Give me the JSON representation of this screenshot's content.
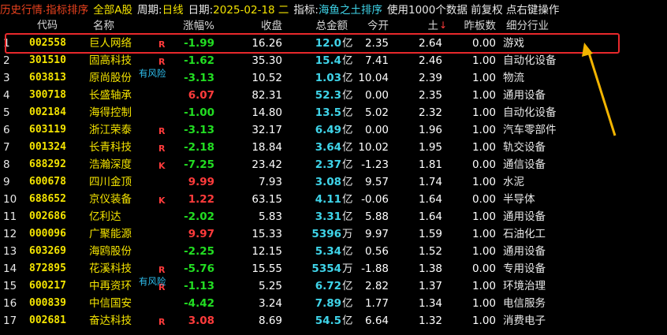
{
  "topbar": {
    "history": "历史行情",
    "sep": ".",
    "sort_title": "指标排序",
    "market": "全部A股",
    "period_label": "周期:",
    "period_value": "日线",
    "date_label": "日期:",
    "date_value": "2025-02-18 二",
    "indicator_label": "指标:",
    "indicator_value": "海鱼之土排序",
    "hint": "使用1000个数据 前复权 点右键操作"
  },
  "columns": {
    "code": "代码",
    "name": "名称",
    "change": "涨幅%",
    "close": "收盘",
    "amount": "总金额",
    "open": "今开",
    "indicator": "土",
    "prev_limit": "昨板数",
    "sector": "细分行业"
  },
  "colors": {
    "up": "#ff3b3b",
    "down": "#22dd22",
    "code": "#f4e400",
    "amount": "#3fd4e9",
    "highlight": "#e8292c",
    "arrow": "#f2b400"
  },
  "rows": [
    {
      "idx": "1",
      "code": "002558",
      "name": "巨人网络",
      "flag": "R",
      "risk": "",
      "change": "-1.99",
      "dir": "dn",
      "close": "16.26",
      "amount": "12.0",
      "unit": "亿",
      "open": "2.35",
      "ind": "2.64",
      "prev": "0.00",
      "sector": "游戏"
    },
    {
      "idx": "2",
      "code": "301510",
      "name": "固高科技",
      "flag": "R",
      "risk": "",
      "change": "-1.62",
      "dir": "dn",
      "close": "35.30",
      "amount": "15.4",
      "unit": "亿",
      "open": "7.41",
      "ind": "2.46",
      "prev": "1.00",
      "sector": "自动化设备"
    },
    {
      "idx": "3",
      "code": "603813",
      "name": "原尚股份",
      "flag": "",
      "risk": "有风险",
      "change": "-3.13",
      "dir": "dn",
      "close": "10.52",
      "amount": "1.03",
      "unit": "亿",
      "open": "10.04",
      "ind": "2.39",
      "prev": "1.00",
      "sector": "物流"
    },
    {
      "idx": "4",
      "code": "300718",
      "name": "长盛轴承",
      "flag": "",
      "risk": "",
      "change": "6.07",
      "dir": "up",
      "close": "82.31",
      "amount": "52.3",
      "unit": "亿",
      "open": "0.00",
      "ind": "2.35",
      "prev": "1.00",
      "sector": "通用设备"
    },
    {
      "idx": "5",
      "code": "002184",
      "name": "海得控制",
      "flag": "",
      "risk": "",
      "change": "-1.00",
      "dir": "dn",
      "close": "14.80",
      "amount": "13.5",
      "unit": "亿",
      "open": "5.02",
      "ind": "2.32",
      "prev": "1.00",
      "sector": "自动化设备"
    },
    {
      "idx": "6",
      "code": "603119",
      "name": "浙江荣泰",
      "flag": "R",
      "risk": "",
      "change": "-3.13",
      "dir": "dn",
      "close": "32.17",
      "amount": "6.49",
      "unit": "亿",
      "open": "0.00",
      "ind": "1.96",
      "prev": "1.00",
      "sector": "汽车零部件"
    },
    {
      "idx": "7",
      "code": "001324",
      "name": "长青科技",
      "flag": "R",
      "risk": "",
      "change": "-2.18",
      "dir": "dn",
      "close": "18.84",
      "amount": "3.64",
      "unit": "亿",
      "open": "10.02",
      "ind": "1.95",
      "prev": "1.00",
      "sector": "轨交设备"
    },
    {
      "idx": "8",
      "code": "688292",
      "name": "浩瀚深度",
      "flag": "K",
      "risk": "",
      "change": "-7.25",
      "dir": "dn",
      "close": "23.42",
      "amount": "2.37",
      "unit": "亿",
      "open": "-1.23",
      "ind": "1.81",
      "prev": "0.00",
      "sector": "通信设备"
    },
    {
      "idx": "9",
      "code": "600678",
      "name": "四川金顶",
      "flag": "",
      "risk": "",
      "change": "9.99",
      "dir": "up",
      "close": "7.93",
      "amount": "3.08",
      "unit": "亿",
      "open": "9.57",
      "ind": "1.74",
      "prev": "1.00",
      "sector": "水泥"
    },
    {
      "idx": "10",
      "code": "688652",
      "name": "京仪装备",
      "flag": "K",
      "risk": "",
      "change": "1.22",
      "dir": "up",
      "close": "63.15",
      "amount": "4.11",
      "unit": "亿",
      "open": "-0.06",
      "ind": "1.64",
      "prev": "0.00",
      "sector": "半导体"
    },
    {
      "idx": "11",
      "code": "002686",
      "name": "亿利达",
      "flag": "",
      "risk": "",
      "change": "-2.02",
      "dir": "dn",
      "close": "5.83",
      "amount": "3.31",
      "unit": "亿",
      "open": "5.88",
      "ind": "1.64",
      "prev": "1.00",
      "sector": "通用设备"
    },
    {
      "idx": "12",
      "code": "000096",
      "name": "广聚能源",
      "flag": "",
      "risk": "",
      "change": "9.97",
      "dir": "up",
      "close": "15.33",
      "amount": "5396",
      "unit": "万",
      "open": "9.97",
      "ind": "1.59",
      "prev": "1.00",
      "sector": "石油化工"
    },
    {
      "idx": "13",
      "code": "603269",
      "name": "海鸥股份",
      "flag": "",
      "risk": "",
      "change": "-2.25",
      "dir": "dn",
      "close": "12.15",
      "amount": "5.34",
      "unit": "亿",
      "open": "0.56",
      "ind": "1.52",
      "prev": "1.00",
      "sector": "通用设备"
    },
    {
      "idx": "14",
      "code": "872895",
      "name": "花溪科技",
      "flag": "R",
      "risk": "",
      "change": "-5.76",
      "dir": "dn",
      "close": "15.55",
      "amount": "5354",
      "unit": "万",
      "open": "-1.88",
      "ind": "1.38",
      "prev": "0.00",
      "sector": "专用设备"
    },
    {
      "idx": "15",
      "code": "600217",
      "name": "中再资环",
      "flag": "R",
      "risk": "有风险",
      "change": "-1.13",
      "dir": "dn",
      "close": "5.25",
      "amount": "6.72",
      "unit": "亿",
      "open": "2.82",
      "ind": "1.37",
      "prev": "1.00",
      "sector": "环境治理"
    },
    {
      "idx": "16",
      "code": "000839",
      "name": "中信国安",
      "flag": "",
      "risk": "",
      "change": "-4.42",
      "dir": "dn",
      "close": "3.24",
      "amount": "7.89",
      "unit": "亿",
      "open": "1.77",
      "ind": "1.34",
      "prev": "1.00",
      "sector": "电信服务"
    },
    {
      "idx": "17",
      "code": "002681",
      "name": "奋达科技",
      "flag": "R",
      "risk": "",
      "change": "3.08",
      "dir": "up",
      "close": "8.69",
      "amount": "54.5",
      "unit": "亿",
      "open": "6.64",
      "ind": "1.32",
      "prev": "1.00",
      "sector": "消费电子"
    }
  ]
}
